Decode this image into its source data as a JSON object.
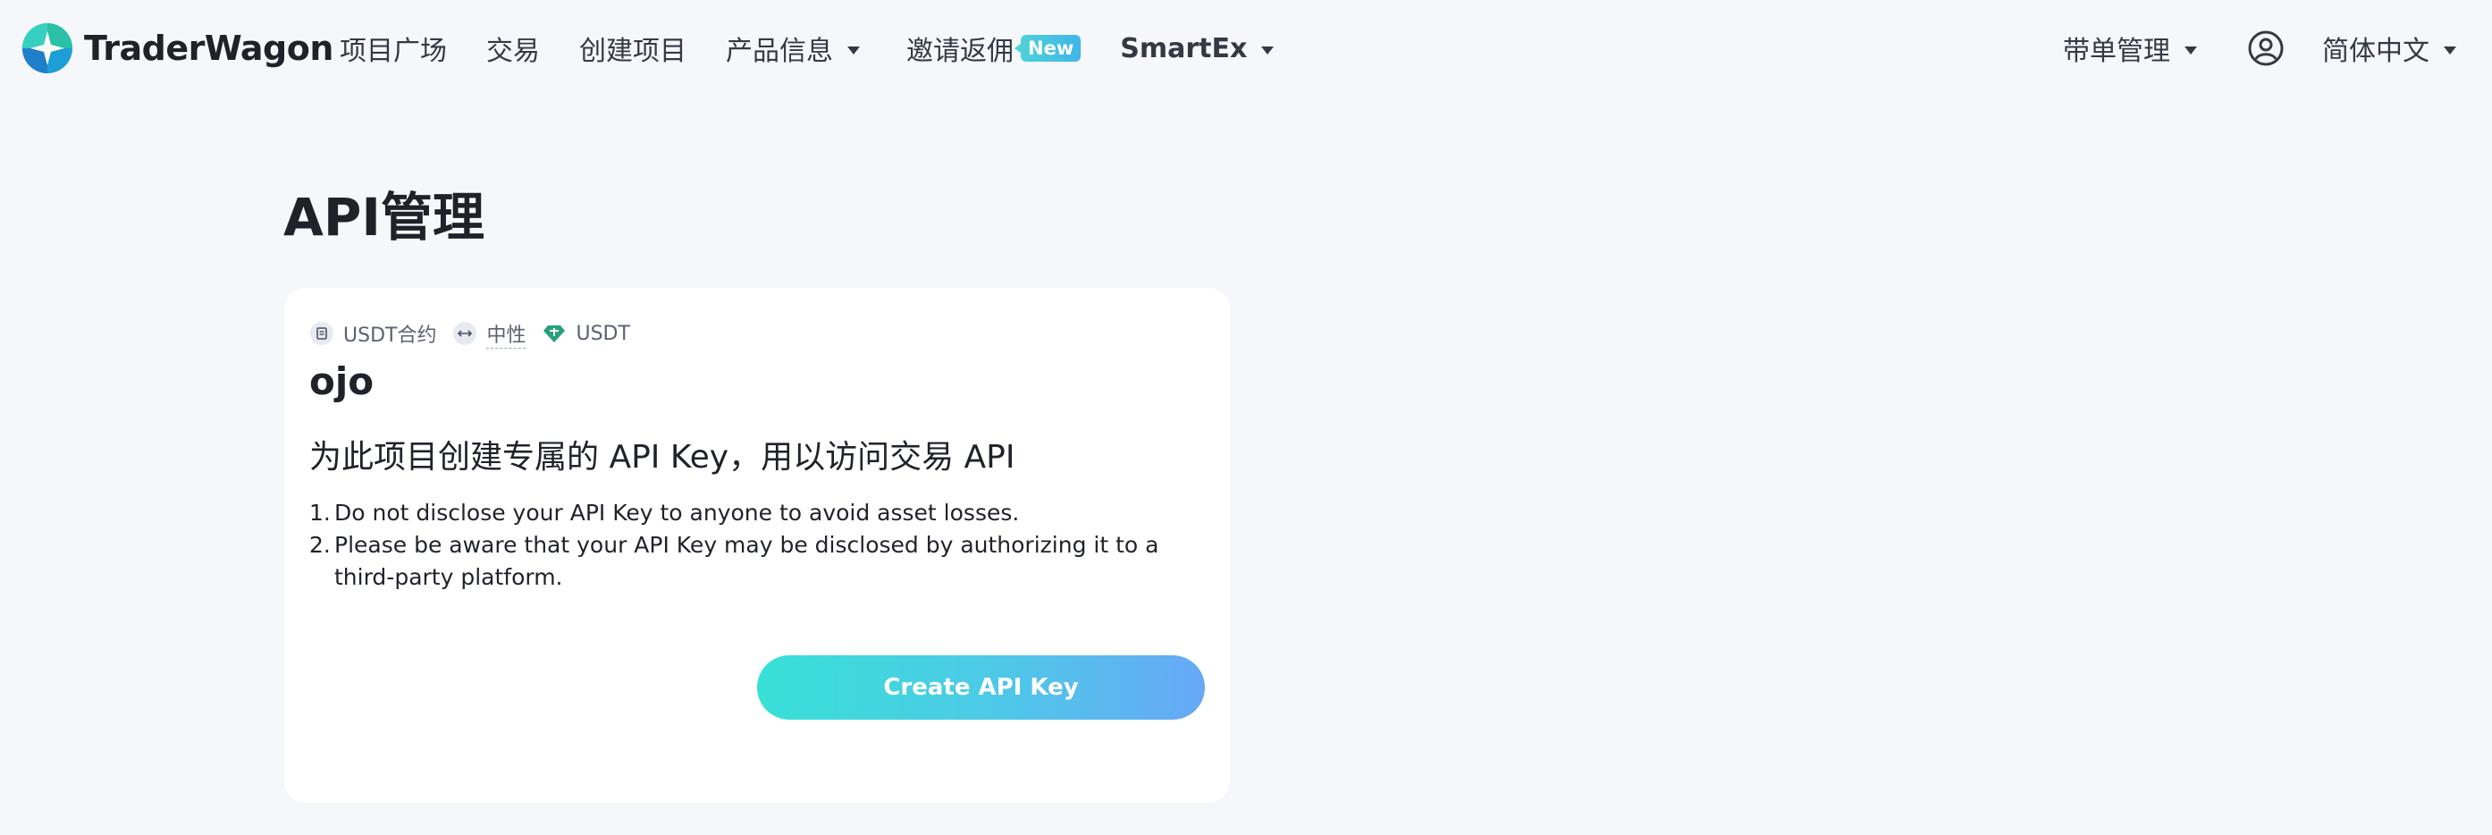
{
  "header": {
    "logo_text": "TraderWagon",
    "nav": [
      {
        "label": "项目广场"
      },
      {
        "label": "交易"
      },
      {
        "label": "创建项目"
      },
      {
        "label": "产品信息"
      },
      {
        "label": "邀请返佣",
        "badge": "New"
      },
      {
        "label": "SmartEx"
      }
    ],
    "copy_trading": "带单管理",
    "language": "简体中文"
  },
  "page": {
    "title": "API管理"
  },
  "card": {
    "tags": {
      "contract": "USDT合约",
      "mode": "中性",
      "asset": "USDT"
    },
    "project_name": "ojo",
    "heading": "为此项目创建专属的 API Key，用以访问交易 API",
    "notes": [
      {
        "num": "1.",
        "text": "Do not disclose your API Key to anyone to avoid asset losses."
      },
      {
        "num": "2.",
        "text": "Please be aware that your API Key may be disclosed by authorizing it to a third-party platform."
      }
    ],
    "button_label": "Create API Key"
  },
  "colors": {
    "background": "#f6f7fb",
    "button_gradient_start": "#37e0d6",
    "button_gradient_end": "#67a8f7",
    "badge": "#4fd1d9",
    "usdt_icon": "#26a17b"
  },
  "icons": {
    "logo": "traderwagon-logo-icon",
    "contract": "contract-icon",
    "mode": "arrows-horizontal-icon",
    "asset": "usdt-diamond-icon",
    "user": "user-circle-icon",
    "dropdown": "caret-down-icon"
  }
}
